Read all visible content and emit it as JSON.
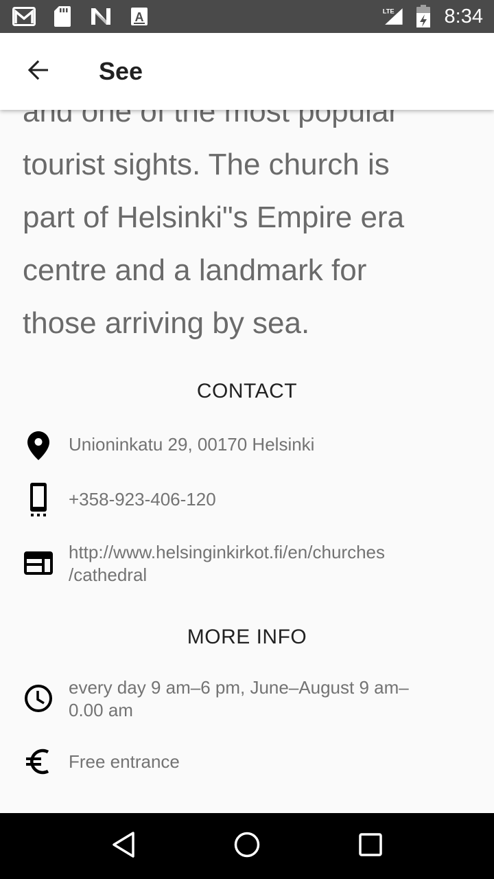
{
  "status_bar": {
    "time": "8:34",
    "network": "LTE",
    "icons": [
      "gmail-icon",
      "sd-card-icon",
      "n-logo-icon",
      "a-letter-icon",
      "lte-signal-icon",
      "battery-icon"
    ]
  },
  "app_bar": {
    "title": "See",
    "back_icon": "arrow-back-icon"
  },
  "description": {
    "lines": [
      "and one of the most popular",
      "tourist sights. The church is",
      "part of Helsinki\"s Empire era",
      "centre and a landmark for",
      "those arriving by sea."
    ]
  },
  "contact": {
    "heading": "CONTACT",
    "address": "Unioninkatu 29, 00170 Helsinki",
    "phone": "+358-923-406-120",
    "website_line1": "http://www.helsinginkirkot.fi/en/churches",
    "website_line2": "/cathedral"
  },
  "more_info": {
    "heading": "MORE INFO",
    "hours_line1": "every day 9 am–6 pm, June–August 9 am–",
    "hours_line2": "0.00 am",
    "price": "Free entrance"
  },
  "nav_bar": {
    "icons": [
      "back-triangle-icon",
      "home-circle-icon",
      "recents-square-icon"
    ]
  },
  "colors": {
    "status_bar": "#4a4a4a",
    "background": "#fafafa",
    "text_primary": "#212121",
    "text_secondary": "#737373",
    "description_text": "#6a6a6a"
  }
}
